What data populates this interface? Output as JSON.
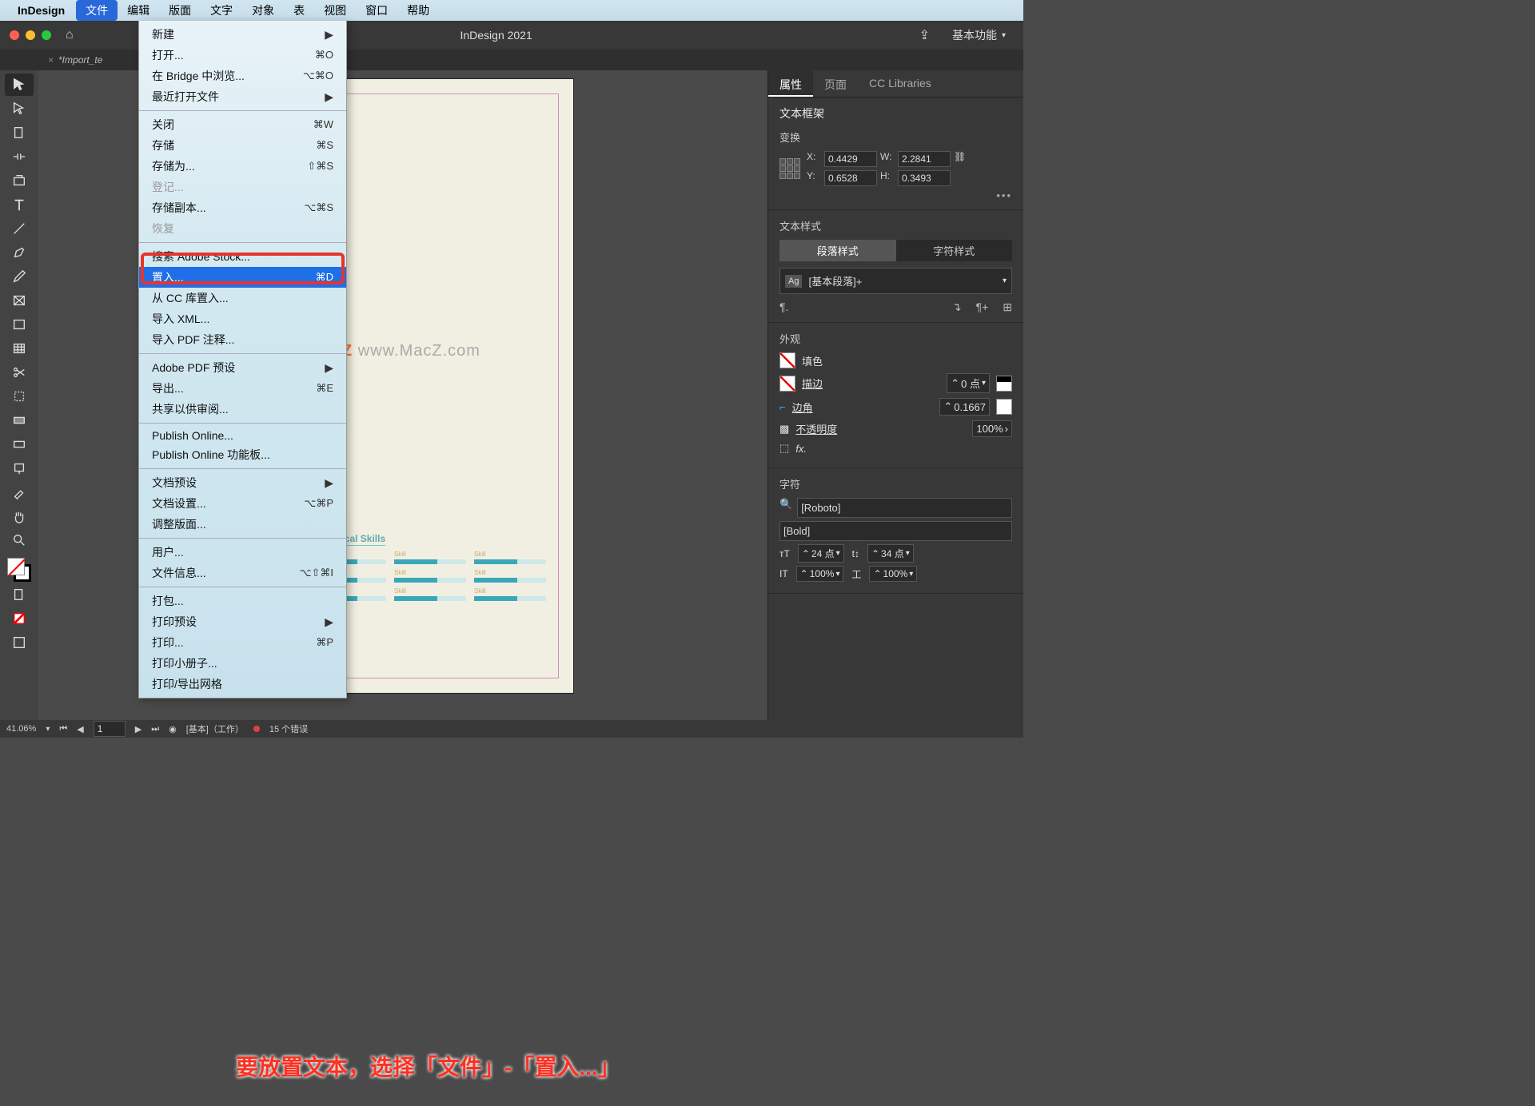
{
  "menubar": {
    "app": "InDesign",
    "items": [
      "文件",
      "编辑",
      "版面",
      "文字",
      "对象",
      "表",
      "视图",
      "窗口",
      "帮助"
    ],
    "active_index": 0
  },
  "titlebar": {
    "title": "InDesign 2021",
    "workspace": "基本功能"
  },
  "tab": {
    "label": "*Import_te",
    "close": "×"
  },
  "dropdown": {
    "groups": [
      [
        {
          "label": "新建",
          "sub": true
        },
        {
          "label": "打开...",
          "shortcut": "⌘O"
        },
        {
          "label": "在 Bridge 中浏览...",
          "shortcut": "⌥⌘O"
        },
        {
          "label": "最近打开文件",
          "sub": true
        }
      ],
      [
        {
          "label": "关闭",
          "shortcut": "⌘W"
        },
        {
          "label": "存储",
          "shortcut": "⌘S"
        },
        {
          "label": "存储为...",
          "shortcut": "⇧⌘S"
        },
        {
          "label": "登记...",
          "disabled": true
        },
        {
          "label": "存储副本...",
          "shortcut": "⌥⌘S"
        },
        {
          "label": "恢复",
          "disabled": true
        }
      ],
      [
        {
          "label": "搜索 Adobe Stock..."
        },
        {
          "label": "置入...",
          "shortcut": "⌘D",
          "highlight": true
        },
        {
          "label": "从 CC 库置入..."
        },
        {
          "label": "导入 XML..."
        },
        {
          "label": "导入 PDF 注释..."
        }
      ],
      [
        {
          "label": "Adobe PDF 预设",
          "sub": true
        },
        {
          "label": "导出...",
          "shortcut": "⌘E"
        },
        {
          "label": "共享以供审阅..."
        }
      ],
      [
        {
          "label": "Publish Online..."
        },
        {
          "label": "Publish Online 功能板..."
        }
      ],
      [
        {
          "label": "文档预设",
          "sub": true
        },
        {
          "label": "文档设置...",
          "shortcut": "⌥⌘P"
        },
        {
          "label": "调整版面..."
        }
      ],
      [
        {
          "label": "用户..."
        },
        {
          "label": "文件信息...",
          "shortcut": "⌥⇧⌘I"
        }
      ],
      [
        {
          "label": "打包..."
        },
        {
          "label": "打印预设",
          "sub": true
        },
        {
          "label": "打印...",
          "shortcut": "⌘P"
        },
        {
          "label": "打印小册子..."
        },
        {
          "label": "打印/导出网格"
        }
      ]
    ]
  },
  "canvas": {
    "section": "Technical Skills",
    "skill_label": "Skill",
    "watermark": "www.MacZ.com"
  },
  "rightpanel": {
    "tabs": [
      "属性",
      "页面",
      "CC Libraries"
    ],
    "heading": "文本框架",
    "transform": {
      "label": "变换",
      "x_label": "X:",
      "x": "0.4429",
      "y_label": "Y:",
      "y": "0.6528",
      "w_label": "W:",
      "w": "2.2841",
      "h_label": "H:",
      "h": "0.3493"
    },
    "textstyle": {
      "label": "文本样式",
      "para_tab": "段落样式",
      "char_tab": "字符样式",
      "current": "[基本段落]+"
    },
    "appearance": {
      "label": "外观",
      "fill": "填色",
      "stroke": "描边",
      "stroke_val": "0 点",
      "corner": "边角",
      "corner_val": "0.1667",
      "opacity": "不透明度",
      "opacity_val": "100%"
    },
    "character": {
      "label": "字符",
      "font": "[Roboto]",
      "weight": "[Bold]",
      "size": "24 点",
      "leading": "34 点",
      "hscale": "100%",
      "vscale": "100%"
    }
  },
  "statusbar": {
    "zoom": "41.06%",
    "page": "1",
    "profile": "[基本]（工作）",
    "errors": "15 个错误"
  },
  "instruction": "要放置文本，选择「文件」-「置入...」"
}
